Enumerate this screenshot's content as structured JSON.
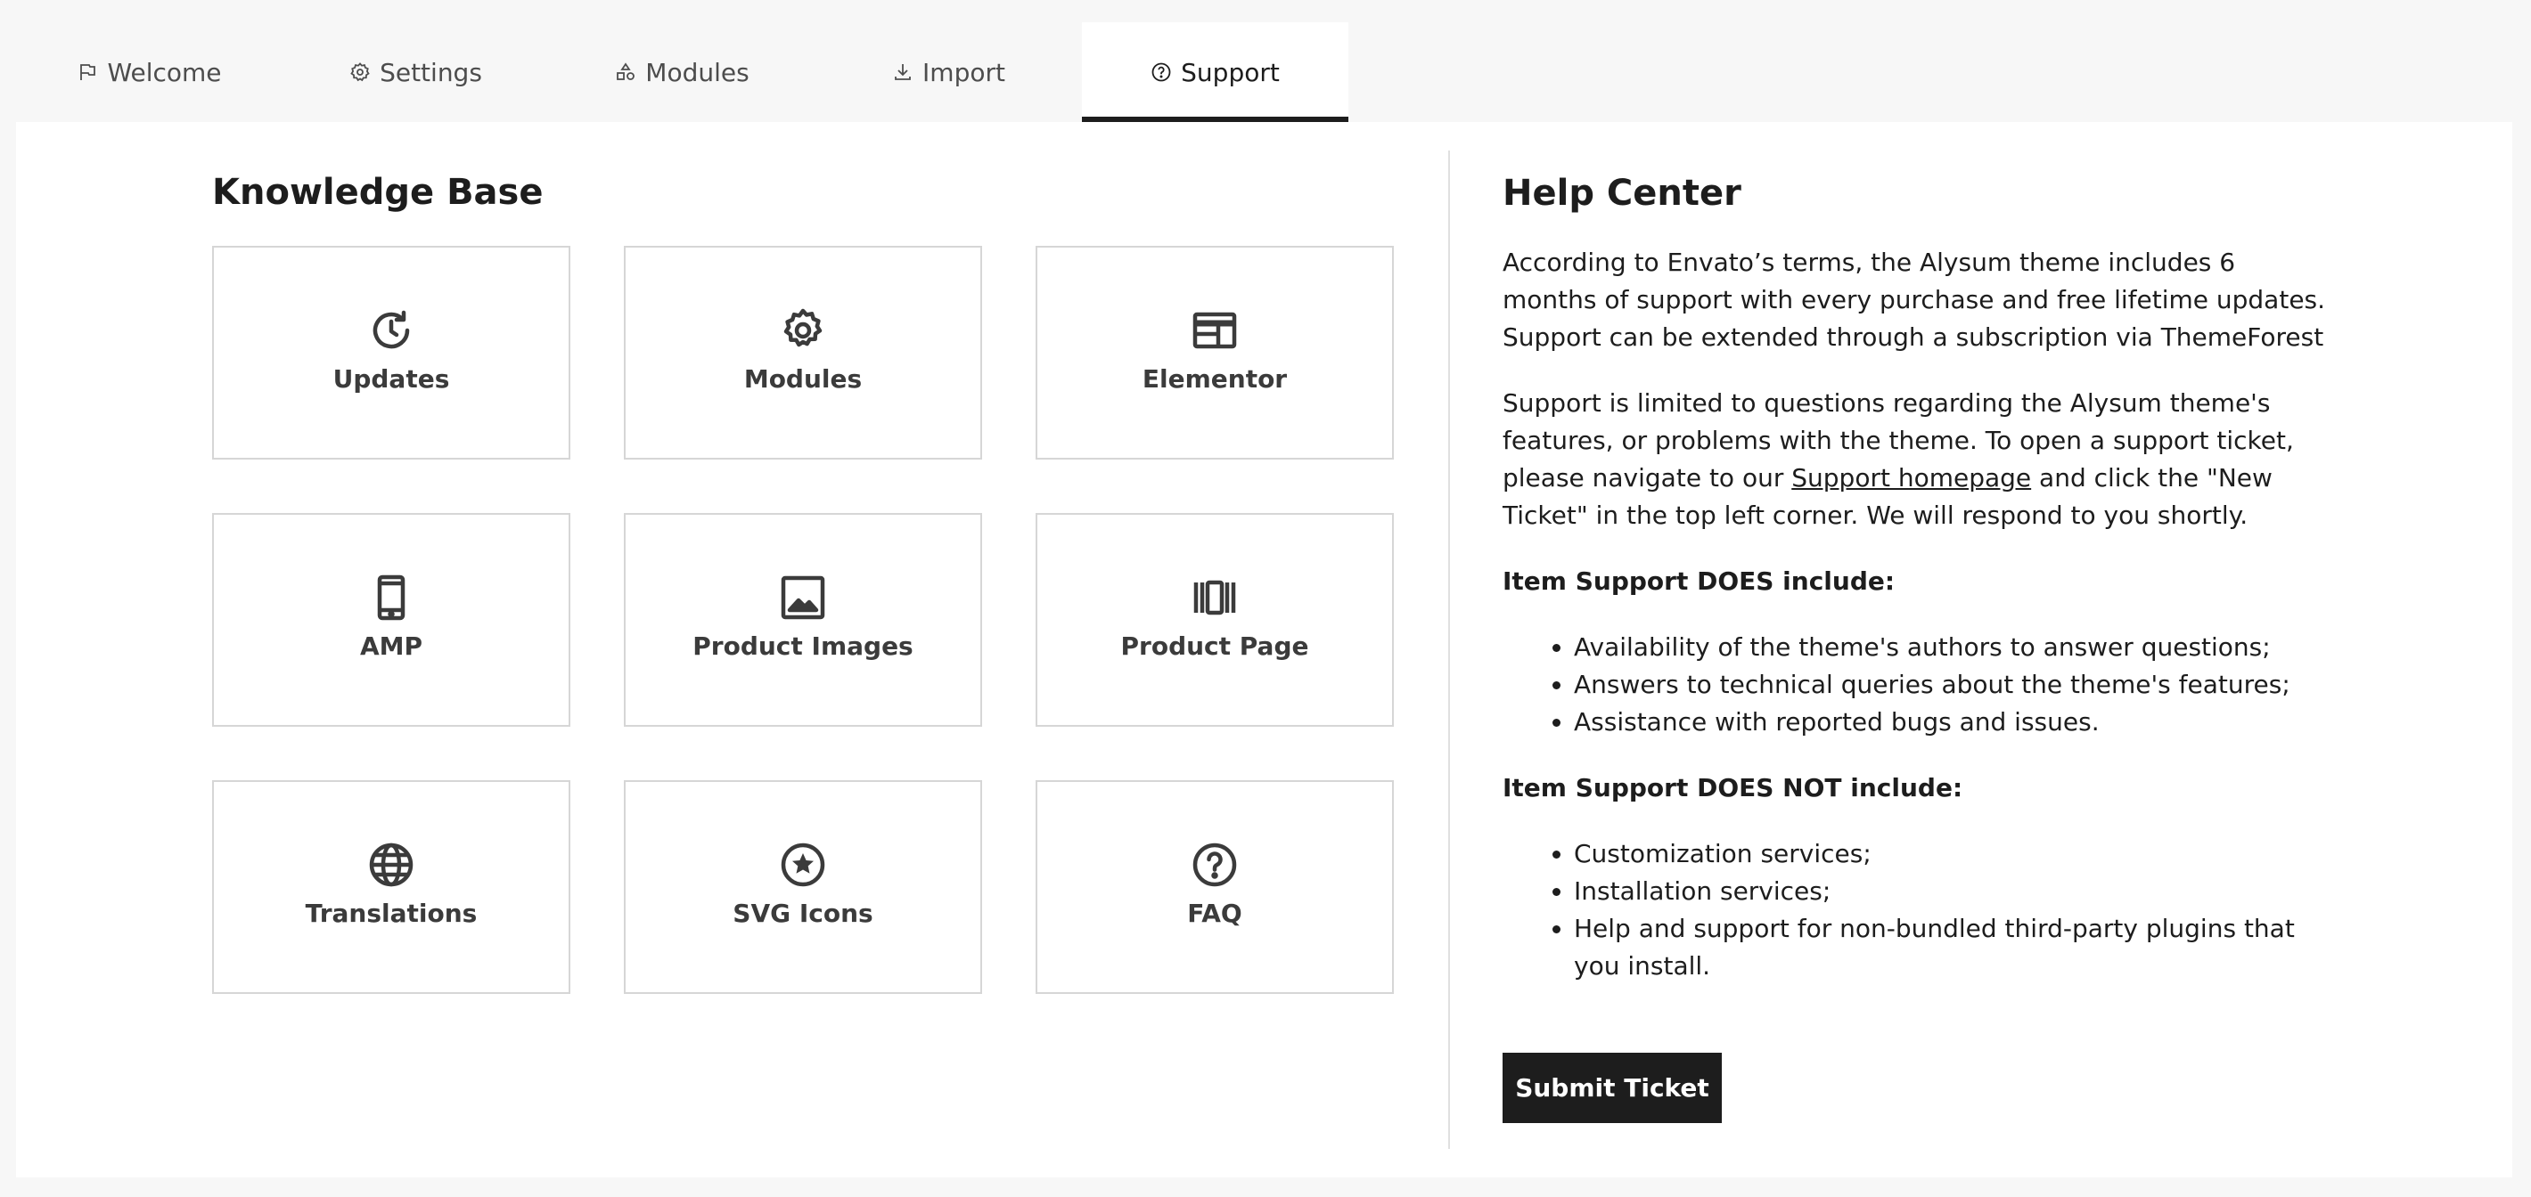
{
  "tabs": [
    {
      "label": "Welcome",
      "icon": "flag-icon",
      "active": false
    },
    {
      "label": "Settings",
      "icon": "gear-icon",
      "active": false
    },
    {
      "label": "Modules",
      "icon": "shapes-icon",
      "active": false
    },
    {
      "label": "Import",
      "icon": "download-icon",
      "active": false
    },
    {
      "label": "Support",
      "icon": "help-circle-icon",
      "active": true
    }
  ],
  "knowledge_base": {
    "title": "Knowledge Base",
    "cards": [
      {
        "label": "Updates",
        "icon": "update-clock-icon"
      },
      {
        "label": "Modules",
        "icon": "gear-icon"
      },
      {
        "label": "Elementor",
        "icon": "layout-icon"
      },
      {
        "label": "AMP",
        "icon": "mobile-icon"
      },
      {
        "label": "Product Images",
        "icon": "image-icon"
      },
      {
        "label": "Product Page",
        "icon": "carousel-icon"
      },
      {
        "label": "Translations",
        "icon": "globe-icon"
      },
      {
        "label": "SVG Icons",
        "icon": "star-circle-icon"
      },
      {
        "label": "FAQ",
        "icon": "question-circle-icon"
      }
    ]
  },
  "help_center": {
    "title": "Help Center",
    "intro": "According to Envato’s terms, the Alysum theme includes 6 months of support with every purchase and free lifetime updates. Support can be extended through a subscription via ThemeForest",
    "support_before_link": "Support is limited to questions regarding the Alysum theme's features, or problems with the theme. To open a support ticket, please navigate to our ",
    "support_link": "Support homepage",
    "support_after_link": " and click the \"New Ticket\" in the top left corner. We will respond to you shortly.",
    "includes_heading": "Item Support DOES include:",
    "includes": [
      "Availability of the theme's authors to answer questions;",
      "Answers to technical queries about the theme's features;",
      "Assistance with reported bugs and issues."
    ],
    "excludes_heading": "Item Support DOES NOT include:",
    "excludes": [
      "Customization services;",
      "Installation services;",
      "Help and support for non-bundled third-party plugins that you install."
    ],
    "submit_label": "Submit Ticket"
  },
  "colors": {
    "accent": "#1d1d1d",
    "card_border": "#d6d6d6",
    "page_bg": "#f7f7f7"
  }
}
